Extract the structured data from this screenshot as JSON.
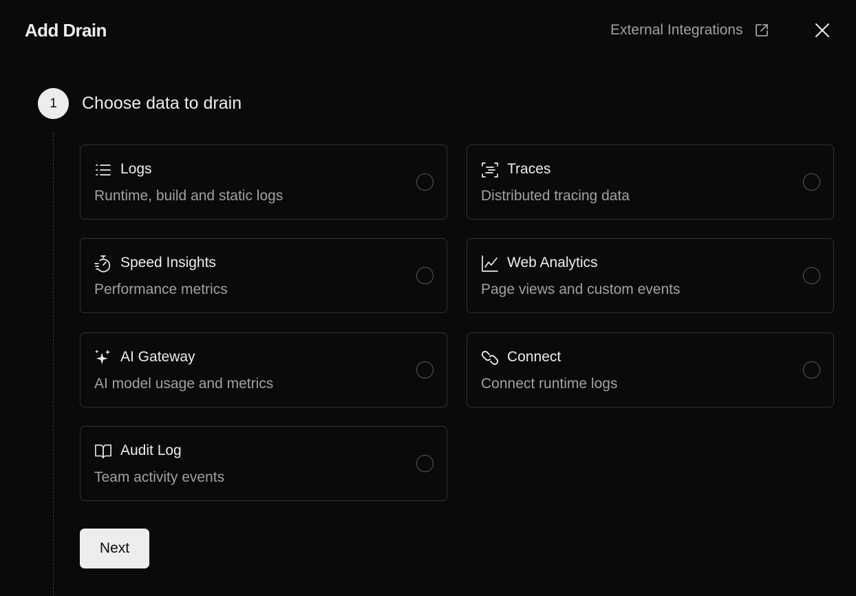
{
  "dialog": {
    "title": "Add Drain",
    "external_link_label": "External Integrations"
  },
  "step": {
    "number": "1",
    "title": "Choose data to drain"
  },
  "options": [
    {
      "icon": "list-icon",
      "title": "Logs",
      "description": "Runtime, build and static logs",
      "selected": false
    },
    {
      "icon": "traces-icon",
      "title": "Traces",
      "description": "Distributed tracing data",
      "selected": false
    },
    {
      "icon": "stopwatch-icon",
      "title": "Speed Insights",
      "description": "Performance metrics",
      "selected": false
    },
    {
      "icon": "line-chart-icon",
      "title": "Web Analytics",
      "description": "Page views and custom events",
      "selected": false
    },
    {
      "icon": "sparkles-icon",
      "title": "AI Gateway",
      "description": "AI model usage and metrics",
      "selected": false
    },
    {
      "icon": "connect-icon",
      "title": "Connect",
      "description": "Connect runtime logs",
      "selected": false
    },
    {
      "icon": "book-icon",
      "title": "Audit Log",
      "description": "Team activity events",
      "selected": false
    }
  ],
  "actions": {
    "next_label": "Next"
  },
  "colors": {
    "background": "#0a0a0a",
    "text_primary": "#ededed",
    "text_secondary": "#a1a1a1",
    "border": "#333333"
  }
}
